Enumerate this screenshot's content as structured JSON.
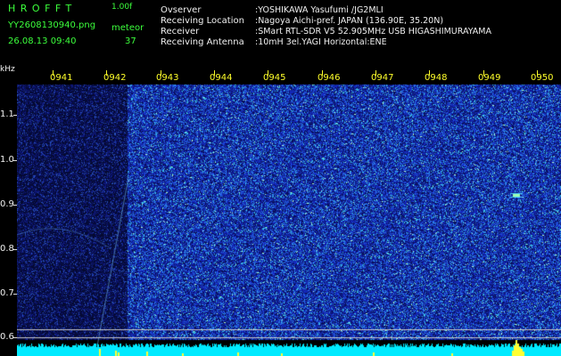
{
  "header": {
    "app_name": "HROFFT",
    "version": "1.00f",
    "file_name": "YY2608130940.png",
    "mode": "meteor",
    "timestamp": "26.08.13 09:40",
    "count": "37"
  },
  "info": [
    {
      "label": "Ovserver",
      "value": ":YOSHIKAWA Yasufumi /JG2MLI"
    },
    {
      "label": "Receiving Location",
      "value": ":Nagoya Aichi-pref. JAPAN (136.90E, 35.20N)"
    },
    {
      "label": "Receiver",
      "value": ":SMart RTL-SDR V5 52.905MHz USB HIGASHIMURAYAMA"
    },
    {
      "label": "Receiving Antenna",
      "value": ":10mH 3el.YAGI Horizontal:ENE"
    }
  ],
  "y_axis": {
    "unit": "kHz",
    "ticks": [
      "1.1",
      "1.0",
      "0.9",
      "0.8",
      "0.7",
      "0.6"
    ]
  },
  "time_axis": {
    "labels": [
      "0941",
      "0942",
      "0943",
      "0944",
      "0945",
      "0946",
      "0947",
      "0948",
      "0949",
      "0950"
    ]
  },
  "colors": {
    "text_green": "#3cff3c",
    "text_yellow": "#ffff2a",
    "spectrum_bg": "#1c2c9a",
    "dark_band": "#0a1450",
    "signal": "#00ffff",
    "power_cyan": "#00f0ff"
  }
}
